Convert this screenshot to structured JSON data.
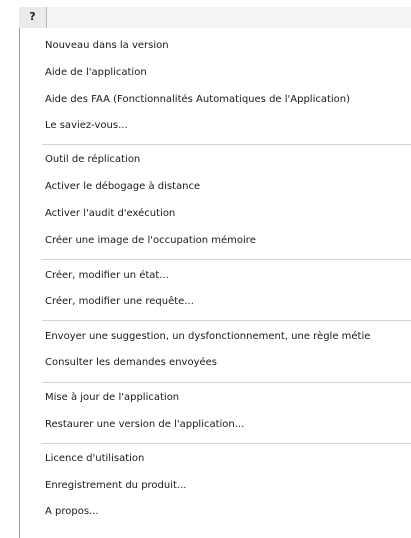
{
  "menubar": {
    "help_label": "?"
  },
  "menu": {
    "groups": [
      {
        "items": [
          "Nouveau dans la version",
          "Aide de l'application",
          "Aide des FAA (Fonctionnalités Automatiques de l'Application)",
          "Le saviez-vous..."
        ]
      },
      {
        "items": [
          "Outil de réplication",
          "Activer le débogage à distance",
          "Activer l'audit d'exécution",
          "Créer une image de l'occupation mémoire"
        ]
      },
      {
        "items": [
          "Créer, modifier un état...",
          "Créer, modifier une requête..."
        ]
      },
      {
        "items": [
          "Envoyer une suggestion, un dysfonctionnement, une règle métie",
          "Consulter les demandes envoyées"
        ]
      },
      {
        "items": [
          "Mise à jour de l'application",
          "Restaurer une version de l'application..."
        ]
      },
      {
        "items": [
          "Licence d'utilisation",
          "Enregistrement du produit...",
          "A propos..."
        ]
      }
    ]
  }
}
